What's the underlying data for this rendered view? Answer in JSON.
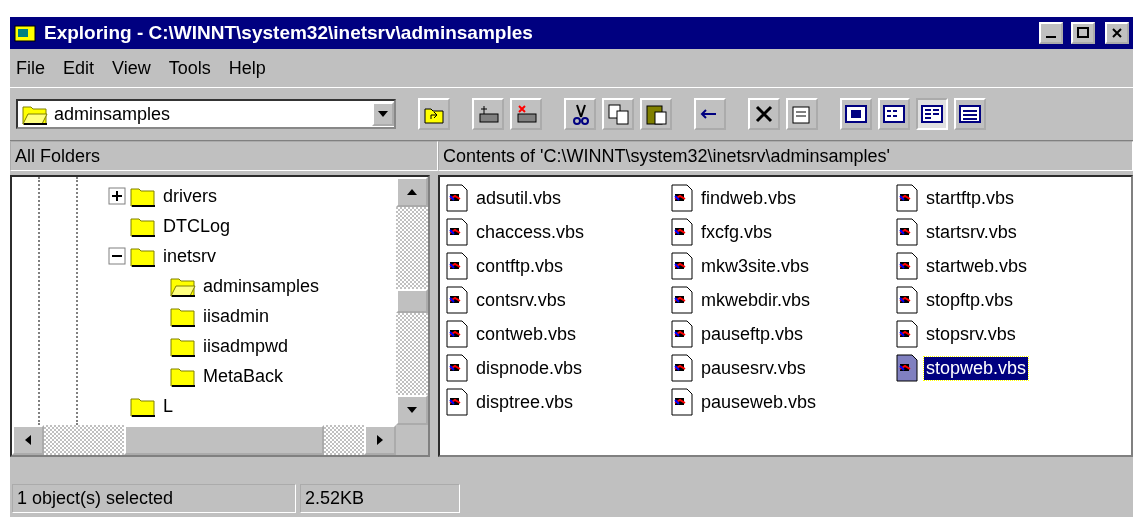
{
  "window": {
    "title": "Exploring - C:\\WINNT\\system32\\inetsrv\\adminsamples"
  },
  "menu": [
    "File",
    "Edit",
    "View",
    "Tools",
    "Help"
  ],
  "address": {
    "value": "adminsamples"
  },
  "view_buttons": [
    {
      "selected": false
    },
    {
      "selected": false
    },
    {
      "selected": true
    },
    {
      "selected": false
    }
  ],
  "folders_pane": {
    "title": "All Folders",
    "tree": [
      {
        "label": "drivers",
        "expanded": false,
        "selected": false
      },
      {
        "label": "DTCLog",
        "selected": false
      },
      {
        "label": "inetsrv",
        "expanded": true,
        "selected": false,
        "children": [
          {
            "label": "adminsamples",
            "selected": true
          },
          {
            "label": "iisadmin",
            "selected": false
          },
          {
            "label": "iisadmpwd",
            "selected": false
          },
          {
            "label": "MetaBack",
            "selected": false
          }
        ]
      },
      {
        "label": "L",
        "selected": false
      }
    ]
  },
  "contents": {
    "title": "Contents of 'C:\\WINNT\\system32\\inetsrv\\adminsamples'",
    "files": [
      {
        "name": "adsutil.vbs",
        "selected": false
      },
      {
        "name": "chaccess.vbs",
        "selected": false
      },
      {
        "name": "contftp.vbs",
        "selected": false
      },
      {
        "name": "contsrv.vbs",
        "selected": false
      },
      {
        "name": "contweb.vbs",
        "selected": false
      },
      {
        "name": "dispnode.vbs",
        "selected": false
      },
      {
        "name": "disptree.vbs",
        "selected": false
      },
      {
        "name": "findweb.vbs",
        "selected": false
      },
      {
        "name": "fxcfg.vbs",
        "selected": false
      },
      {
        "name": "mkw3site.vbs",
        "selected": false
      },
      {
        "name": "mkwebdir.vbs",
        "selected": false
      },
      {
        "name": "pauseftp.vbs",
        "selected": false
      },
      {
        "name": "pausesrv.vbs",
        "selected": false
      },
      {
        "name": "pauseweb.vbs",
        "selected": false
      },
      {
        "name": "startftp.vbs",
        "selected": false
      },
      {
        "name": "startsrv.vbs",
        "selected": false
      },
      {
        "name": "startweb.vbs",
        "selected": false
      },
      {
        "name": "stopftp.vbs",
        "selected": false
      },
      {
        "name": "stopsrv.vbs",
        "selected": false
      },
      {
        "name": "stopweb.vbs",
        "selected": true
      }
    ]
  },
  "status_bar": [
    "1 object(s) selected",
    "2.52KB"
  ]
}
